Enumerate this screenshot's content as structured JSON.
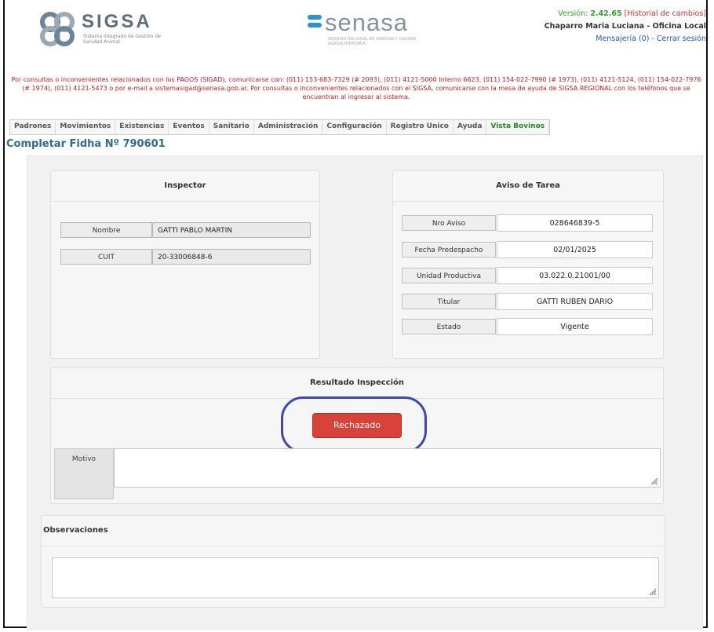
{
  "header": {
    "logo_title": "SIGSA",
    "logo_subtitle": "Sistema Integrado de Gestión de Sanidad Animal",
    "brand_name": "senasa",
    "brand_subtitle": "SERVICIO NACIONAL DE SANIDAD Y CALIDAD AGROALIMENTARIA",
    "version_label": "Versión:",
    "version_number": "2.42.65",
    "history_link": "[Historial de cambios]",
    "user_name": "Chaparro Maria Luciana - Oficina Local",
    "messages_link": "Mensajería (0)",
    "separator": "-",
    "logout_link": "Cerrar sesión"
  },
  "notice": "Por consultas o inconvenientes relacionados con los PAGOS (SIGAD), comunicarse con: (011) 153-683-7329 (# 2093), (011) 4121-5000 Interno 6623, (011) 154-022-7990 (# 1973), (011) 4121-5124, (011) 154-022-7976 (# 1974), (011) 4121-5473 o por e-mail a sistemasigad@senasa.gob.ar. Por consultas o inconvenientes relacionados con el SIGSA, comunicarse con la mesa de ayuda de SIGSA REGIONAL con los teléfonos que se encuentran al ingresar al sistema.",
  "nav": {
    "items": [
      "Padrones",
      "Movimientos",
      "Existencias",
      "Eventos",
      "Sanitario",
      "Administración",
      "Configuración",
      "Registro Unico",
      "Ayuda",
      "Vista Bovinos"
    ]
  },
  "page_title": "Completar Fidha Nº 790601",
  "inspector": {
    "title": "Inspector",
    "nombre_label": "Nombre",
    "nombre_value": "GATTI PABLO MARTIN",
    "cuit_label": "CUIT",
    "cuit_value": "20-33006848-6"
  },
  "aviso": {
    "title": "Aviso de Tarea",
    "rows": [
      {
        "label": "Nro Aviso",
        "value": "028646839-5"
      },
      {
        "label": "Fecha Predespacho",
        "value": "02/01/2025"
      },
      {
        "label": "Unidad Productiva",
        "value": "03.022.0.21001/00"
      },
      {
        "label": "Titular",
        "value": "GATTI RUBEN DARIO"
      },
      {
        "label": "Estado",
        "value": "Vigente"
      }
    ]
  },
  "resultado": {
    "title": "Resultado Inspección",
    "button_label": "Rechazado",
    "motivo_label": "Motivo",
    "motivo_value": ""
  },
  "observaciones": {
    "title": "Observaciones",
    "value": ""
  },
  "colors": {
    "accent_title": "#2d6e8e",
    "reject_button": "#d9423a",
    "highlight_circle": "#3f46b0",
    "notice_red": "#d01818",
    "nav_green": "#1c8a1c"
  }
}
